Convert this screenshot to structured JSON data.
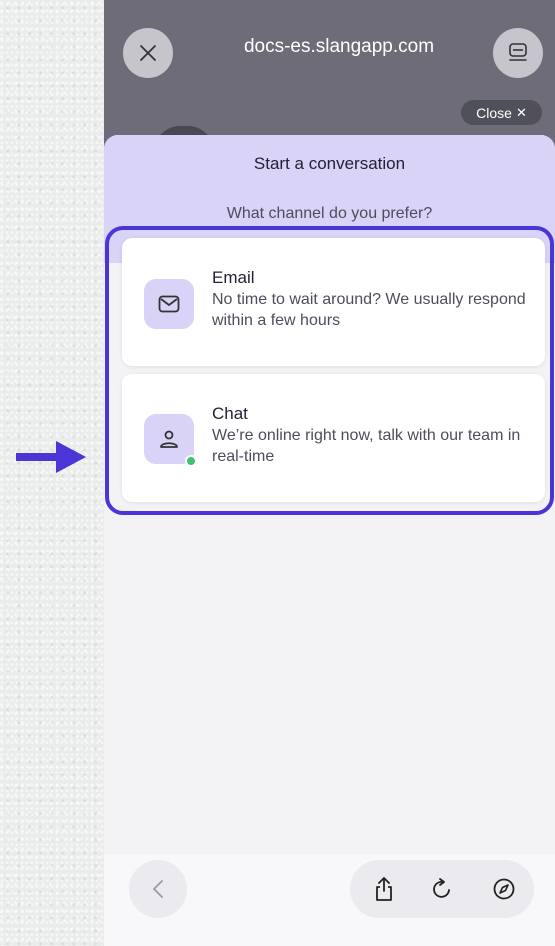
{
  "browser": {
    "url": "docs-es.slangapp.com",
    "close_icon": "close-icon",
    "reader_icon": "reader-mode-icon"
  },
  "widget": {
    "close_label": "Close",
    "close_glyph": "✕",
    "title": "Start a conversation",
    "subtitle": "What channel do you prefer?",
    "options": [
      {
        "title": "Email",
        "description": "No time to wait around? We usually respond within a few hours",
        "icon": "envelope-icon"
      },
      {
        "title": "Chat",
        "description": "We’re online right now, talk with our team in real-time",
        "icon": "person-icon",
        "status": "online"
      }
    ]
  },
  "toolbar": {
    "items": [
      "back-icon",
      "share-icon",
      "reload-icon",
      "compass-icon"
    ]
  },
  "colors": {
    "accent": "#4a35d6",
    "header_bg": "#d8d3f7",
    "topbar_bg": "#6e6c79",
    "online": "#3ec273"
  }
}
